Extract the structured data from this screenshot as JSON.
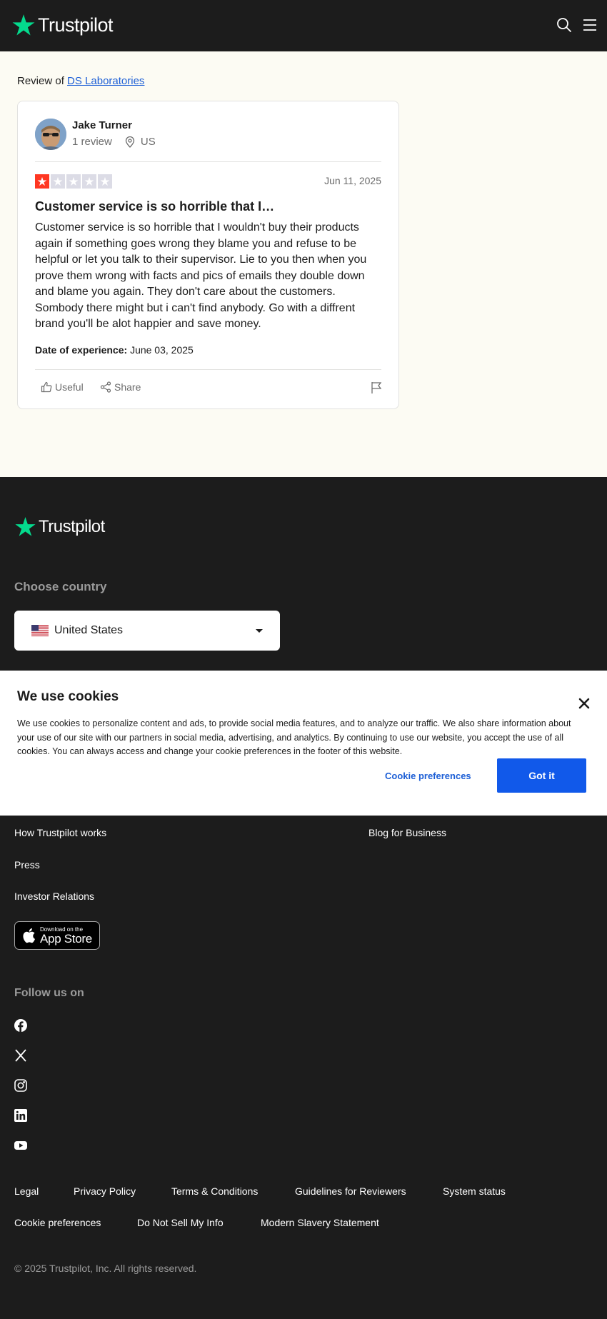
{
  "header": {
    "logo_text": "Trustpilot"
  },
  "review": {
    "review_of_prefix": "Review of",
    "company_name": "DS Laboratories",
    "user_name": "Jake Turner",
    "review_count": "1 review",
    "country": "US",
    "rating": 1,
    "date": "Jun 11, 2025",
    "title": "Customer service is so horrible that I…",
    "body": "Customer service is so horrible that I wouldn't buy their products again if something goes wrong they blame you and refuse to be helpful or let you talk to their supervisor. Lie to you then when you prove them wrong with facts and pics of emails they double down and blame you again. They don't care about the customers. Sombody there might but i can't find anybody. Go with a diffrent brand you'll be alot happier and save money.",
    "experience_label": "Date of experience:",
    "experience_date": "June 03, 2025",
    "useful_label": "Useful",
    "share_label": "Share"
  },
  "footer": {
    "logo_text": "Trustpilot",
    "choose_country_label": "Choose country",
    "country_selected": "United States",
    "links_left": [
      "How Trustpilot works",
      "Press",
      "Investor Relations"
    ],
    "links_right": [
      "Blog for Business"
    ],
    "appstore_small": "Download on the",
    "appstore_big": "App Store",
    "follow_label": "Follow us on",
    "social_icons": [
      "facebook-icon",
      "x-icon",
      "instagram-icon",
      "linkedin-icon",
      "youtube-icon"
    ],
    "legal_row1": [
      "Legal",
      "Privacy Policy",
      "Terms & Conditions",
      "Guidelines for Reviewers",
      "System status"
    ],
    "legal_row2": [
      "Cookie preferences",
      "Do Not Sell My Info",
      "Modern Slavery Statement"
    ],
    "copyright": "© 2025 Trustpilot, Inc. All rights reserved."
  },
  "cookie": {
    "title": "We use cookies",
    "text": "We use cookies to personalize content and ads, to provide social media features, and to analyze our traffic. We also share information about your use of our site with our partners in social media, advertising, and analytics. By continuing to use our website, you accept the use of all cookies. You can always access and change your cookie preferences in the footer of this website.",
    "preferences_label": "Cookie preferences",
    "accept_label": "Got it"
  },
  "colors": {
    "brand_green": "#04da8d",
    "star_red": "#ff3722",
    "link_blue": "#1d5fd6",
    "button_blue": "#1159ea",
    "dark_bg": "#1c1c1c",
    "cream_bg": "#fcfbf3"
  }
}
